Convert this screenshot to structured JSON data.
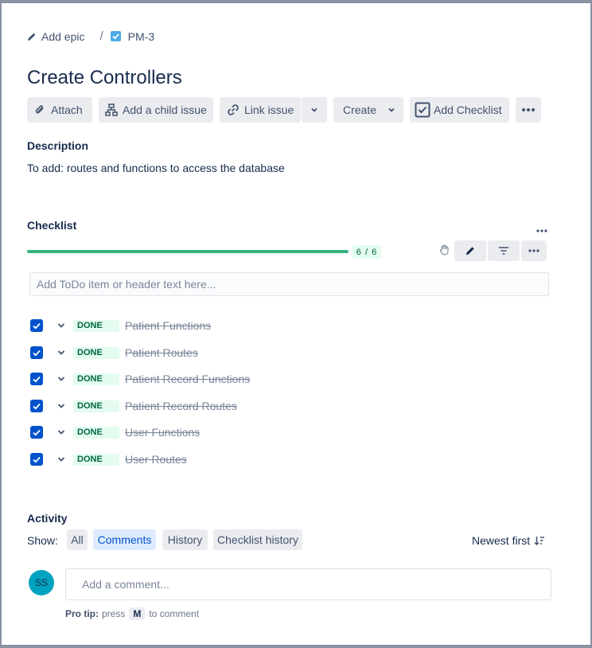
{
  "breadcrumb": {
    "epic_label": "Add epic",
    "separator": "/",
    "issue_key": "PM-3"
  },
  "issue": {
    "title": "Create Controllers"
  },
  "toolbar": {
    "attach": "Attach",
    "add_child": "Add a child issue",
    "link_issue": "Link issue",
    "create": "Create",
    "add_checklist": "Add Checklist"
  },
  "description": {
    "label": "Description",
    "text": "To add: routes and functions to access the database"
  },
  "checklist": {
    "label": "Checklist",
    "progress_text": "6 / 6",
    "progress_fraction": 1.0,
    "input_placeholder": "Add ToDo item or header text here...",
    "items": [
      {
        "status": "DONE",
        "text": "Patient Functions"
      },
      {
        "status": "DONE",
        "text": "Patient Routes"
      },
      {
        "status": "DONE",
        "text": "Patient Record Functions"
      },
      {
        "status": "DONE",
        "text": "Patient Record Routes"
      },
      {
        "status": "DONE",
        "text": "User Functions"
      },
      {
        "status": "DONE",
        "text": "User Routes"
      }
    ]
  },
  "activity": {
    "label": "Activity",
    "show_label": "Show:",
    "filters": [
      "All",
      "Comments",
      "History",
      "Checklist history"
    ],
    "active_filter": "Comments",
    "sort_label": "Newest first"
  },
  "comment": {
    "avatar_initials": "SS",
    "placeholder": "Add a comment...",
    "pro_tip_label": "Pro tip:",
    "pro_tip_pre": "press",
    "pro_tip_key": "M",
    "pro_tip_post": "to comment"
  },
  "colors": {
    "accent": "#0052cc",
    "progress": "#36b37e",
    "done_badge_bg": "#e3fcef",
    "done_badge_text": "#006644",
    "avatar": "#00a3bf"
  }
}
